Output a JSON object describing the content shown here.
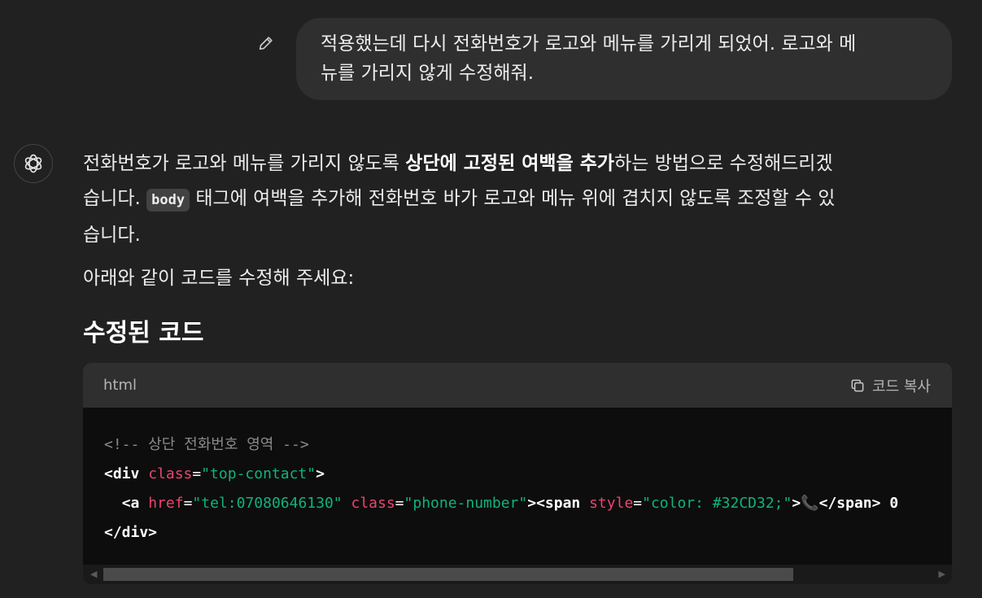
{
  "user_message": {
    "line1": "적용했는데 다시 전화번호가 로고와 메뉴를 가리게 되었어. 로고와 메",
    "line2": "뉴를 가리지 않게 수정해줘."
  },
  "assistant": {
    "p1_part1": "전화번호가 로고와 메뉴를 가리지 않도록 ",
    "p1_bold": "상단에 고정된 여백을 추가",
    "p1_part2": "하는 방법으로 수정해드리겠",
    "p1_line2a": "습니다. ",
    "p1_code": "body",
    "p1_line2b": " 태그에 여백을 추가해 전화번호 바가 로고와 메뉴 위에 겹치지 않도록 조정할 수 있",
    "p1_line3": "습니다.",
    "p2": "아래와 같이 코드를 수정해 주세요:",
    "heading": "수정된 코드"
  },
  "code_block": {
    "language": "html",
    "copy_label": "코드 복사",
    "line1": "<!-- 상단 전화번호 영역 -->",
    "line2_tag_open": "<div ",
    "line2_attr": "class",
    "line2_eq": "=",
    "line2_val": "\"top-contact\"",
    "line2_close": ">",
    "line3_indent": "  ",
    "line3_a": "<a ",
    "line3_attr1": "href",
    "line3_eq1": "=",
    "line3_val1": "\"tel:07080646130\"",
    "line3_sp": " ",
    "line3_attr2": "class",
    "line3_eq2": "=",
    "line3_val2": "\"phone-number\"",
    "line3_mid": "><span ",
    "line3_attr3": "style",
    "line3_eq3": "=",
    "line3_val3": "\"color: #32CD32;\"",
    "line3_gt": ">",
    "line3_emoji": "📞",
    "line3_end": "</span> 0",
    "line4": "</div>"
  },
  "colors": {
    "background": "#212121",
    "bubble": "#2f2f2f",
    "code_bg": "#0d0d0d",
    "attr": "#e9456f",
    "string": "#10b27f",
    "comment": "#8a8a8a"
  },
  "icons": {
    "edit": "pencil-icon",
    "avatar": "openai-logo-icon",
    "copy": "copy-icon"
  }
}
